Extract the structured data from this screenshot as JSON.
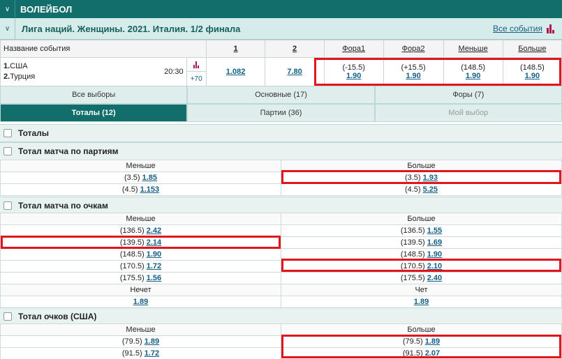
{
  "sport": {
    "title": "ВОЛЕЙБОЛ"
  },
  "league": {
    "title": "Лига наций. Женщины. 2021. Италия. 1/2 финала",
    "all_events": "Все события"
  },
  "columns": {
    "name": "Название события",
    "c1": "1",
    "c2": "2",
    "fora1": "Фора1",
    "fora2": "Фора2",
    "less": "Меньше",
    "more": "Больше"
  },
  "event": {
    "team1_num": "1.",
    "team1": "США",
    "team2_num": "2.",
    "team2": "Турция",
    "time": "20:30",
    "more_markets": "+70",
    "odd1": "1.082",
    "odd2": "7.80",
    "fora1_param": "(-15.5)",
    "fora1_odd": "1.90",
    "fora2_param": "(+15.5)",
    "fora2_odd": "1.90",
    "less_param": "(148.5)",
    "less_odd": "1.90",
    "more_param": "(148.5)",
    "more_odd": "1.90"
  },
  "tabs": {
    "row1": [
      "Все выборы",
      "Основные (17)",
      "Форы (7)"
    ],
    "row2": [
      "Тоталы (12)",
      "Партии (36)",
      "Мой выбор"
    ]
  },
  "groups": {
    "totals": "Тоталы",
    "by_sets": {
      "title": "Тотал матча по партиям",
      "left": "Меньше",
      "right": "Больше",
      "rows": [
        {
          "lp": "(3.5)",
          "lo": "1.85",
          "rp": "(3.5)",
          "ro": "1.93"
        },
        {
          "lp": "(4.5)",
          "lo": "1.153",
          "rp": "(4.5)",
          "ro": "5.25"
        }
      ]
    },
    "by_points": {
      "title": "Тотал матча по очкам",
      "left": "Меньше",
      "right": "Больше",
      "rows": [
        {
          "lp": "(136.5)",
          "lo": "2.42",
          "rp": "(136.5)",
          "ro": "1.55"
        },
        {
          "lp": "(139.5)",
          "lo": "2.14",
          "rp": "(139.5)",
          "ro": "1.69"
        },
        {
          "lp": "(148.5)",
          "lo": "1.90",
          "rp": "(148.5)",
          "ro": "1.90"
        },
        {
          "lp": "(170.5)",
          "lo": "1.72",
          "rp": "(170.5)",
          "ro": "2.10"
        },
        {
          "lp": "(175.5)",
          "lo": "1.56",
          "rp": "(175.5)",
          "ro": "2.40"
        }
      ],
      "odd_label": "Нечет",
      "even_label": "Чет",
      "odd_val": "1.89",
      "even_val": "1.89"
    },
    "usa_points": {
      "title": "Тотал очков (США)",
      "left": "Меньше",
      "right": "Больше",
      "rows": [
        {
          "lp": "(79.5)",
          "lo": "1.89",
          "rp": "(79.5)",
          "ro": "1.89"
        },
        {
          "lp": "(91.5)",
          "lo": "1.72",
          "rp": "(91.5)",
          "ro": "2.07"
        }
      ]
    }
  }
}
